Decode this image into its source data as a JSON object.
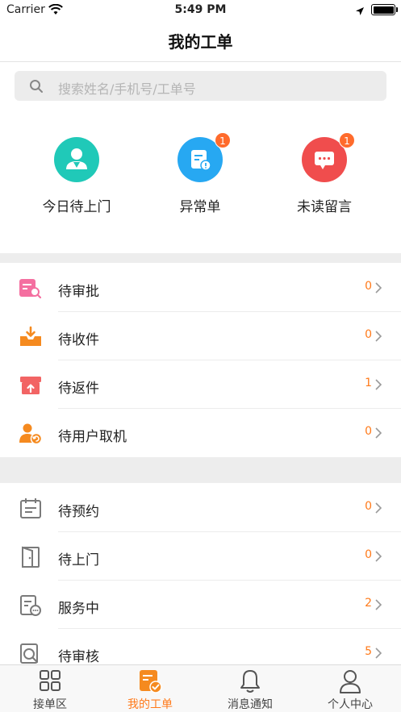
{
  "status_bar": {
    "carrier": "Carrier",
    "time": "5:49 PM"
  },
  "header": {
    "title": "我的工单"
  },
  "search": {
    "placeholder": "搜索姓名/手机号/工单号"
  },
  "quick_actions": [
    {
      "label": "今日待上门",
      "icon": "person-badge-icon",
      "color": "#20c9b8",
      "badge": ""
    },
    {
      "label": "异常单",
      "icon": "document-alert-icon",
      "color": "#27a8f2",
      "badge": "1"
    },
    {
      "label": "未读留言",
      "icon": "chat-bubble-icon",
      "color": "#f04d4d",
      "badge": "1"
    }
  ],
  "section1": [
    {
      "label": "待审批",
      "count": "0",
      "icon": "document-search-icon"
    },
    {
      "label": "待收件",
      "count": "0",
      "icon": "inbox-download-icon"
    },
    {
      "label": "待返件",
      "count": "1",
      "icon": "box-upload-icon"
    },
    {
      "label": "待用户取机",
      "count": "0",
      "icon": "user-return-icon"
    }
  ],
  "section2": [
    {
      "label": "待预约",
      "count": "0",
      "icon": "calendar-icon"
    },
    {
      "label": "待上门",
      "count": "0",
      "icon": "door-icon"
    },
    {
      "label": "服务中",
      "count": "2",
      "icon": "document-progress-icon"
    },
    {
      "label": "待审核",
      "count": "5",
      "icon": "magnifier-icon"
    }
  ],
  "tabbar": [
    {
      "label": "接单区",
      "icon": "grid-icon",
      "active": false
    },
    {
      "label": "我的工单",
      "icon": "orders-check-icon",
      "active": true
    },
    {
      "label": "消息通知",
      "icon": "bell-icon",
      "active": false
    },
    {
      "label": "个人中心",
      "icon": "user-icon",
      "active": false
    }
  ],
  "colors": {
    "accent": "#ff7a1a",
    "count": "#ff7a1a",
    "badge": "#ff6b2c"
  }
}
